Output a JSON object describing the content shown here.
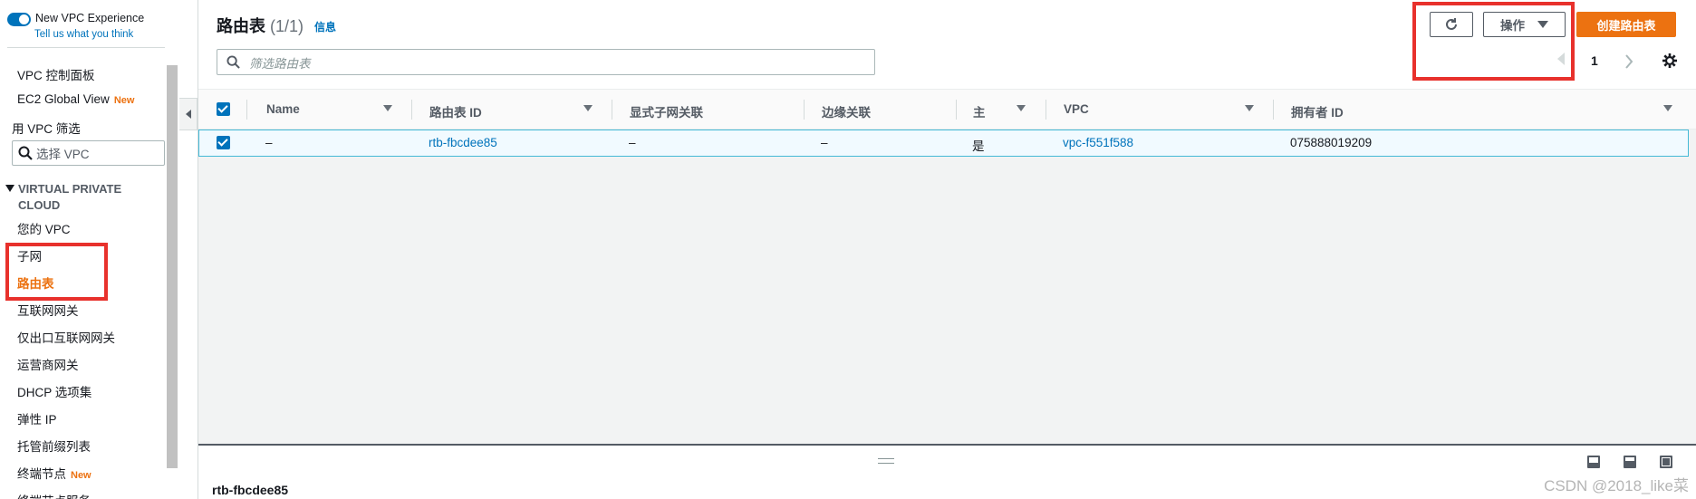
{
  "sidebar": {
    "toggle_title": "New VPC Experience",
    "toggle_link": "Tell us what you think",
    "dashboard": "VPC 控制面板",
    "ec2_global_view": "EC2 Global View",
    "new_badge": "New",
    "filter_label": "用 VPC 筛选",
    "vpc_select_placeholder": "选择 VPC",
    "section_title": "VIRTUAL PRIVATE CLOUD",
    "items": [
      "您的 VPC",
      "子网",
      "路由表",
      "互联网网关",
      "仅出口互联网网关",
      "运营商网关",
      "DHCP 选项集",
      "弹性 IP",
      "托管前缀列表",
      "终端节点",
      "终端节点服务"
    ],
    "active_item": "路由表"
  },
  "header": {
    "title": "路由表",
    "count": "(1/1)",
    "info": "信息",
    "search_placeholder": "筛选路由表",
    "actions_label": "操作",
    "create_label": "创建路由表",
    "page_number": "1"
  },
  "table": {
    "columns": [
      "Name",
      "路由表 ID",
      "显式子网关联",
      "边缘关联",
      "主",
      "VPC",
      "拥有者 ID"
    ],
    "rows": [
      {
        "name": "–",
        "route_table_id": "rtb-fbcdee85",
        "explicit_subnet": "–",
        "edge": "–",
        "main": "是",
        "vpc": "vpc-f551f588",
        "owner": "075888019209"
      }
    ]
  },
  "detail_panel": {
    "title": "rtb-fbcdee85"
  },
  "watermark": "CSDN @2018_like菜",
  "colors": {
    "accent_link": "#0073bb",
    "brand_orange": "#ec7211",
    "highlight_red": "#e8312c"
  }
}
